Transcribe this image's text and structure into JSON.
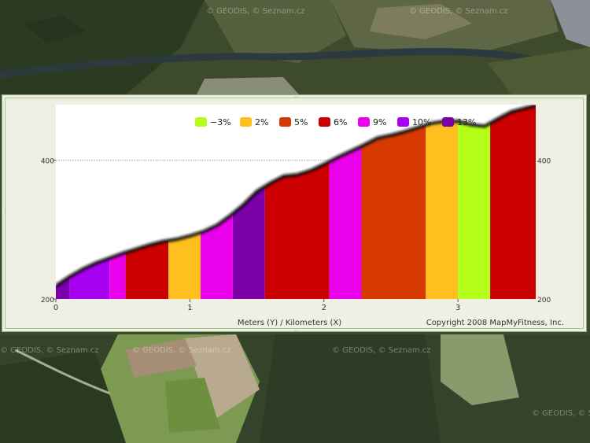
{
  "map": {
    "watermarks": [
      "© GEODIS, © Seznam.cz",
      "© GEODIS, © Seznam.cz",
      "© GEODIS, © Seznam.cz",
      "© GEODIS, © Seznam.cz",
      "© GEODIS, © Seznam.cz",
      "© GEODIS, © Seznam.cz"
    ]
  },
  "chart_data": {
    "type": "area",
    "xlabel": "Meters (Y) / Kilometers (X)",
    "credit": "Copyright 2008 MapMyFitness, Inc.",
    "xlim": [
      0,
      3.58
    ],
    "ylim": [
      200,
      480
    ],
    "x_ticks": [
      "0",
      "1",
      "2",
      "3"
    ],
    "y_ticks": [
      "200",
      "400"
    ],
    "y_ticks_right": [
      "200",
      "400"
    ],
    "legend_position": "top",
    "legend": [
      {
        "label": "−3%",
        "color": "#b3ff1a"
      },
      {
        "label": "2%",
        "color": "#ffbf1f"
      },
      {
        "label": "5%",
        "color": "#d63a00"
      },
      {
        "label": "6%",
        "color": "#cc0000"
      },
      {
        "label": "9%",
        "color": "#ea00ea"
      },
      {
        "label": "10%",
        "color": "#a800f0"
      },
      {
        "label": "13%",
        "color": "#7b00a8"
      }
    ],
    "profile": {
      "x": [
        0,
        0.1,
        0.2,
        0.3,
        0.4,
        0.5,
        0.6,
        0.7,
        0.8,
        0.9,
        1.0,
        1.1,
        1.2,
        1.3,
        1.4,
        1.5,
        1.6,
        1.7,
        1.8,
        1.9,
        2.0,
        2.1,
        2.2,
        2.3,
        2.4,
        2.5,
        2.6,
        2.7,
        2.8,
        2.9,
        3.0,
        3.1,
        3.2,
        3.3,
        3.4,
        3.5,
        3.58
      ],
      "y": [
        219,
        232,
        243,
        252,
        259,
        266,
        272,
        278,
        283,
        286,
        291,
        297,
        306,
        320,
        336,
        355,
        367,
        377,
        379,
        385,
        394,
        404,
        413,
        422,
        432,
        436,
        441,
        447,
        453,
        456,
        456,
        451,
        449,
        460,
        470,
        475,
        479
      ]
    },
    "segments": [
      {
        "x0": 0.0,
        "x1": 0.1,
        "grade": "13%"
      },
      {
        "x0": 0.1,
        "x1": 0.4,
        "grade": "10%"
      },
      {
        "x0": 0.4,
        "x1": 0.52,
        "grade": "9%"
      },
      {
        "x0": 0.52,
        "x1": 0.84,
        "grade": "6%"
      },
      {
        "x0": 0.84,
        "x1": 1.08,
        "grade": "2%"
      },
      {
        "x0": 1.08,
        "x1": 1.32,
        "grade": "9%"
      },
      {
        "x0": 1.32,
        "x1": 1.56,
        "grade": "13%"
      },
      {
        "x0": 1.56,
        "x1": 2.04,
        "grade": "6%"
      },
      {
        "x0": 2.04,
        "x1": 2.28,
        "grade": "9%"
      },
      {
        "x0": 2.28,
        "x1": 2.76,
        "grade": "5%"
      },
      {
        "x0": 2.76,
        "x1": 3.0,
        "grade": "2%"
      },
      {
        "x0": 3.0,
        "x1": 3.24,
        "grade": "−3%"
      },
      {
        "x0": 3.24,
        "x1": 3.58,
        "grade": "6%"
      }
    ],
    "grid_lines_y": [
      400
    ]
  }
}
